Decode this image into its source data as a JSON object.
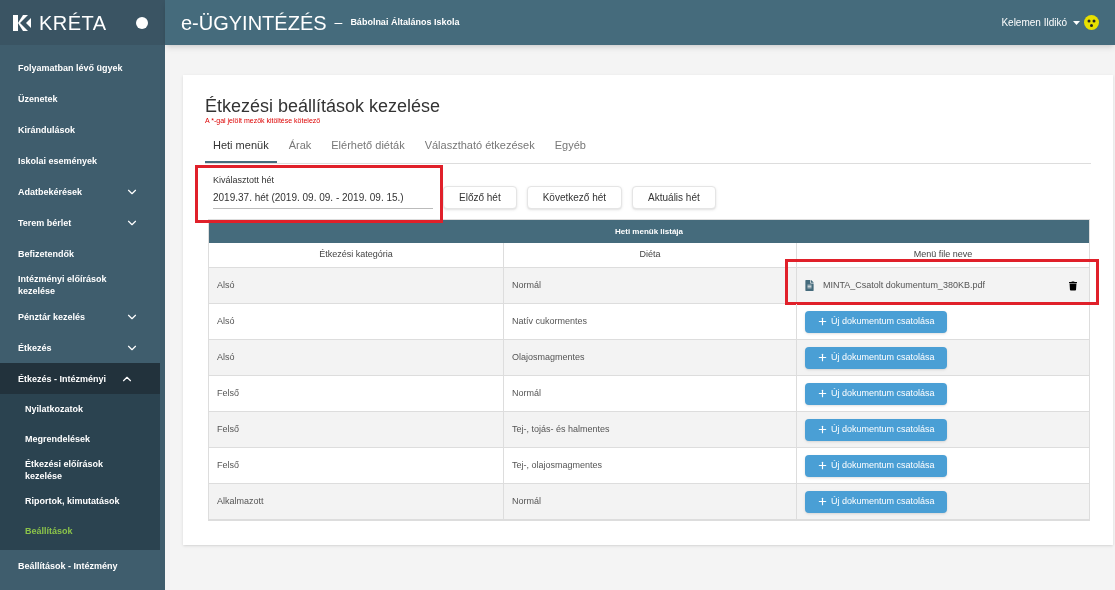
{
  "brand": {
    "name": "KRÉTA"
  },
  "header": {
    "app_title": "e-ÜGYINTÉZÉS",
    "separator": "–",
    "school": "Bábolnai Általános Iskola",
    "user": "Kelemen Ildikó"
  },
  "sidebar": {
    "items": [
      {
        "label": "Folyamatban lévő ügyek",
        "selected": false
      },
      {
        "label": "Üzenetek",
        "selected": false
      },
      {
        "label": "Kirándulások",
        "selected": false
      },
      {
        "label": "Iskolai események",
        "selected": false
      },
      {
        "label": "Adatbekérések",
        "selected": false,
        "expanded": false
      },
      {
        "label": "Terem bérlet",
        "selected": false,
        "expanded": false
      },
      {
        "label": "Befizetendők",
        "selected": false
      },
      {
        "label": "Intézményi előírások kezelése",
        "selected": false
      },
      {
        "label": "Pénztár kezelés",
        "selected": false,
        "expanded": false
      },
      {
        "label": "Étkezés",
        "selected": false,
        "expanded": false
      },
      {
        "label": "Étkezés - Intézményi",
        "selected": false,
        "expanded": true,
        "children": [
          {
            "label": "Nyilatkozatok",
            "selected": false
          },
          {
            "label": "Megrendelések",
            "selected": false
          },
          {
            "label": "Étkezési előírások kezelése",
            "selected": false
          },
          {
            "label": "Riportok, kimutatások",
            "selected": false
          },
          {
            "label": "Beállítások",
            "selected": true
          }
        ]
      },
      {
        "label": "Beállítások - Intézmény",
        "selected": false
      }
    ]
  },
  "page": {
    "title": "Étkezési beállítások kezelése",
    "required_note": "A *-gal jelölt mezők kitöltése kötelező",
    "tabs": [
      {
        "label": "Heti menük",
        "selected": true
      },
      {
        "label": "Árak",
        "selected": false
      },
      {
        "label": "Elérhető diéták",
        "selected": false
      },
      {
        "label": "Választható étkezések",
        "selected": false
      },
      {
        "label": "Egyéb",
        "selected": false
      }
    ],
    "week_picker": {
      "label": "Kiválasztott hét",
      "value": "2019.37. hét (2019. 09. 09. - 2019. 09. 15.)",
      "highlighted": true
    },
    "buttons": [
      "Előző hét",
      "Következő hét",
      "Aktuális hét"
    ],
    "table": {
      "title": "Heti menük listája",
      "columns": [
        "Étkezési kategória",
        "Diéta",
        "Menü file neve"
      ],
      "rows": [
        {
          "category": "Alsó",
          "diet": "Normál",
          "file": {
            "kind": "file",
            "name": "MINTA_Csatolt dokumentum_380KB.pdf",
            "highlighted": true
          }
        },
        {
          "category": "Alsó",
          "diet": "Natív cukormentes",
          "file": {
            "kind": "upload",
            "label": "Új dokumentum csatolása"
          }
        },
        {
          "category": "Alsó",
          "diet": "Olajosmagmentes",
          "file": {
            "kind": "upload",
            "label": "Új dokumentum csatolása"
          }
        },
        {
          "category": "Felső",
          "diet": "Normál",
          "file": {
            "kind": "upload",
            "label": "Új dokumentum csatolása"
          }
        },
        {
          "category": "Felső",
          "diet": "Tej-, tojás- és halmentes",
          "file": {
            "kind": "upload",
            "label": "Új dokumentum csatolása"
          }
        },
        {
          "category": "Felső",
          "diet": "Tej-, olajosmagmentes",
          "file": {
            "kind": "upload",
            "label": "Új dokumentum csatolása"
          }
        },
        {
          "category": "Alkalmazott",
          "diet": "Normál",
          "file": {
            "kind": "upload",
            "label": "Új dokumentum csatolása"
          }
        }
      ]
    }
  }
}
